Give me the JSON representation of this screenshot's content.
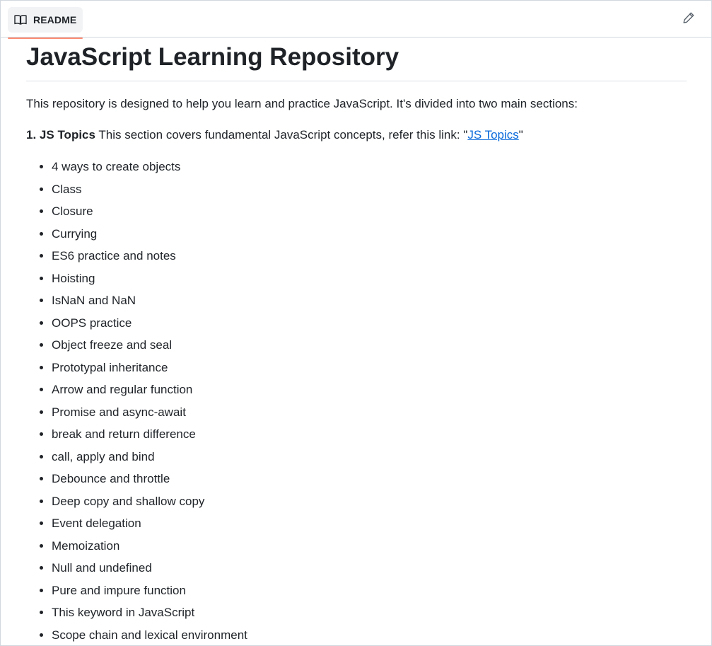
{
  "readme_tab": {
    "label": "README",
    "icon": "book-icon"
  },
  "edit_button": {
    "icon": "pencil-icon"
  },
  "heading": "JavaScript Learning Repository",
  "intro": "This repository is designed to help you learn and practice JavaScript. It's divided into two main sections:",
  "section": {
    "number": "1.",
    "name": "JS Topics",
    "description": "This section covers fundamental JavaScript concepts, refer this link: \"",
    "link_text": "JS Topics",
    "trailing": "\""
  },
  "topics": [
    "4 ways to create objects",
    "Class",
    "Closure",
    "Currying",
    "ES6 practice and notes",
    "Hoisting",
    "IsNaN and NaN",
    "OOPS practice",
    "Object freeze and seal",
    "Prototypal inheritance",
    "Arrow and regular function",
    "Promise and async-await",
    "break and return difference",
    "call, apply and bind",
    "Debounce and throttle",
    "Deep copy and shallow copy",
    "Event delegation",
    "Memoization",
    "Null and undefined",
    "Pure and impure function",
    "This keyword in JavaScript",
    "Scope chain and lexical environment"
  ],
  "colors": {
    "link": "#0969da",
    "tab_underline": "#fd8c73",
    "border": "#d0d7de"
  }
}
